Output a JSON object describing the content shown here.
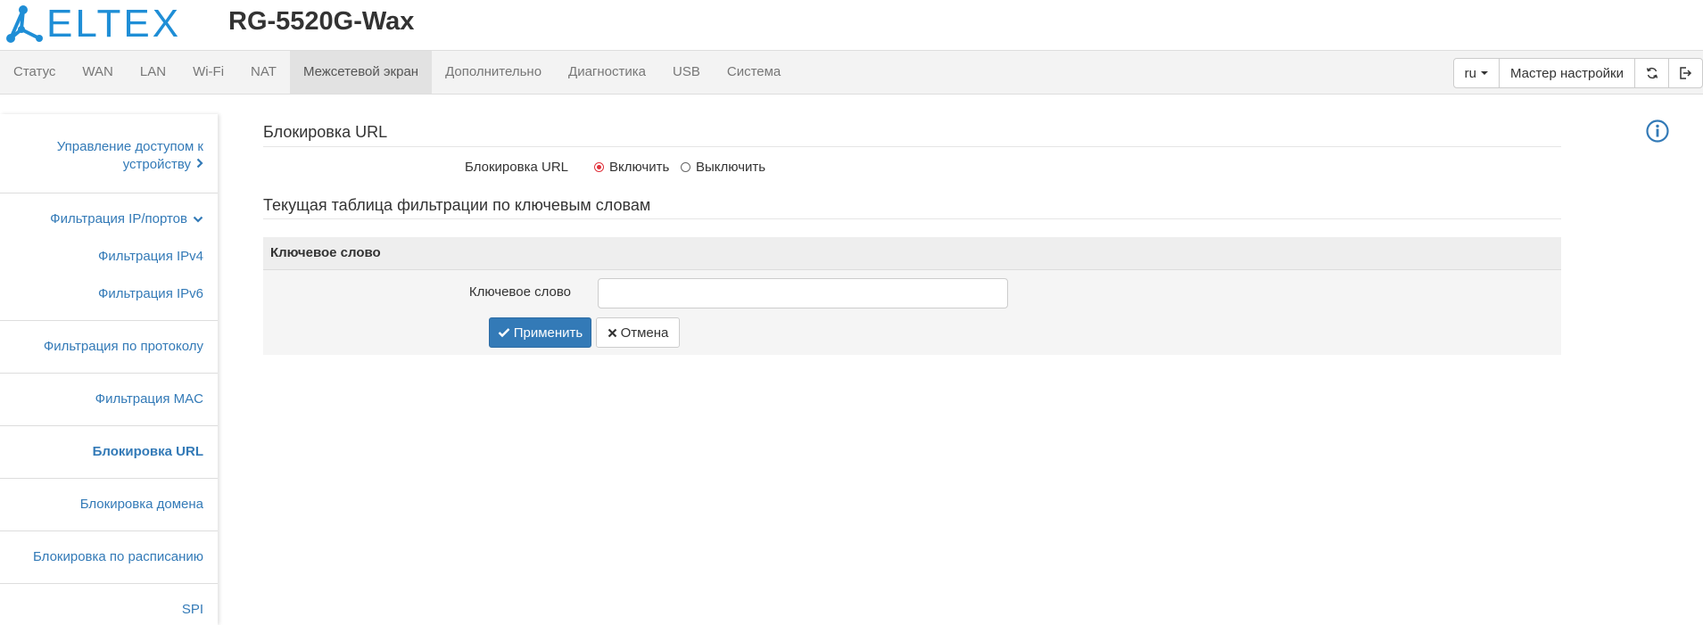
{
  "header": {
    "logo_text": "ELTEX",
    "model": "RG-5520G-Wax"
  },
  "nav": {
    "tabs": [
      {
        "label": "Статус"
      },
      {
        "label": "WAN"
      },
      {
        "label": "LAN"
      },
      {
        "label": "Wi-Fi"
      },
      {
        "label": "NAT"
      },
      {
        "label": "Межсетевой экран",
        "active": true
      },
      {
        "label": "Дополнительно"
      },
      {
        "label": "Диагностика"
      },
      {
        "label": "USB"
      },
      {
        "label": "Система"
      }
    ],
    "language": "ru",
    "wizard_label": "Мастер настройки",
    "icons": [
      "refresh-icon",
      "logout-icon"
    ]
  },
  "sidebar": {
    "items": [
      {
        "label_line1": "Управление доступом к",
        "label_line2": "устройству"
      },
      {
        "label": "Фильтрация IP/портов"
      },
      {
        "label": "Фильтрация IPv4"
      },
      {
        "label": "Фильтрация IPv6"
      },
      {
        "label": "Фильтрация по протоколу"
      },
      {
        "label": "Фильтрация MAC"
      },
      {
        "label": "Блокировка URL",
        "active": true
      },
      {
        "label": "Блокировка домена"
      },
      {
        "label": "Блокировка по расписанию"
      },
      {
        "label": "SPI"
      }
    ]
  },
  "main": {
    "title": "Блокировка URL",
    "url_block": {
      "label": "Блокировка URL",
      "options": [
        "Включить",
        "Выключить"
      ],
      "selected": "Включить"
    },
    "table_title": "Текущая таблица фильтрации по ключевым словам",
    "panel": {
      "header": "Ключевое слово",
      "field_label": "Ключевое слово",
      "field_value": "",
      "apply_label": "Применить",
      "cancel_label": "Отмена"
    }
  },
  "colors": {
    "brand": "#1f8ed6",
    "link": "#337ab7",
    "primary": "#337ab7",
    "radio_on": "#e0323c"
  }
}
